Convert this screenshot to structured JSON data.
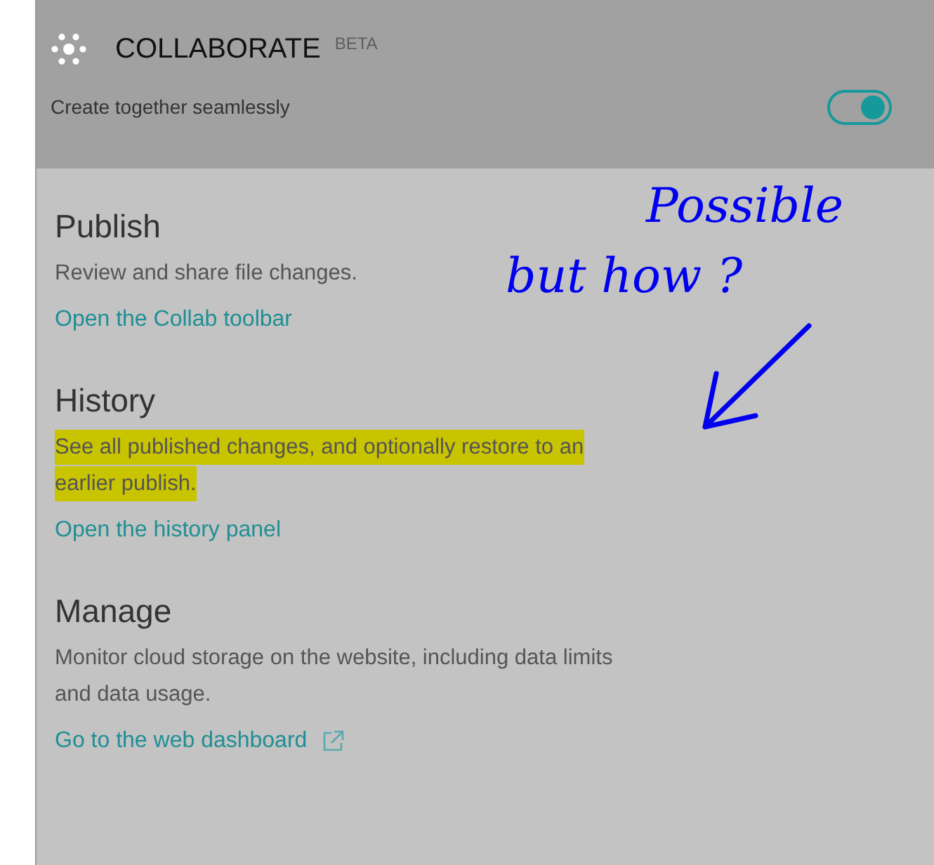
{
  "header": {
    "title": "COLLABORATE",
    "badge": "BETA",
    "subtitle": "Create together seamlessly",
    "toggle": {
      "on": true
    }
  },
  "sections": [
    {
      "title": "Publish",
      "description": "Review and share file changes.",
      "link": "Open the Collab toolbar",
      "highlighted": false,
      "external": false
    },
    {
      "title": "History",
      "description": "See all published changes, and optionally restore to an earlier publish.",
      "link": "Open the history panel",
      "highlighted": true,
      "external": false
    },
    {
      "title": "Manage",
      "description": "Monitor cloud storage on the website, including data limits and data usage.",
      "link": "Go to the web dashboard",
      "highlighted": false,
      "external": true
    }
  ],
  "annotation": {
    "lines": [
      "Possible",
      "but how ?"
    ]
  }
}
